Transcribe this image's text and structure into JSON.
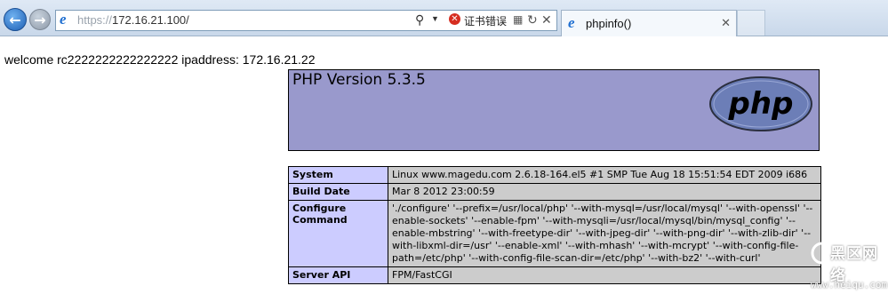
{
  "browser": {
    "address": {
      "protocol": "https://",
      "host": "172.16.21.100/",
      "certificate_error": "证书错误"
    },
    "tab": {
      "title": "phpinfo()"
    }
  },
  "page": {
    "welcome": "welcome rc2222222222222222 ipaddress: 172.16.21.22",
    "php_version": "PHP Version 5.3.5",
    "php_logo_text": "php",
    "rows": [
      {
        "key": "System",
        "value": "Linux www.magedu.com 2.6.18-164.el5 #1 SMP Tue Aug 18 15:51:54 EDT 2009 i686"
      },
      {
        "key": "Build Date",
        "value": "Mar 8 2012 23:00:59"
      },
      {
        "key": "Configure Command",
        "value": "'./configure' '--prefix=/usr/local/php' '--with-mysql=/usr/local/mysql' '--with-openssl' '--enable-sockets' '--enable-fpm' '--with-mysqli=/usr/local/mysql/bin/mysql_config' '--enable-mbstring' '--with-freetype-dir' '--with-jpeg-dir' '--with-png-dir' '--with-zlib-dir' '--with-libxml-dir=/usr' '--enable-xml' '--with-mhash' '--with-mcrypt' '--with-config-file-path=/etc/php' '--with-config-file-scan-dir=/etc/php' '--with-bz2' '--with-curl'"
      },
      {
        "key": "Server API",
        "value": "FPM/FastCGI"
      }
    ]
  },
  "watermark": {
    "site": "黑区网络",
    "url": "www.heiqu.com"
  }
}
